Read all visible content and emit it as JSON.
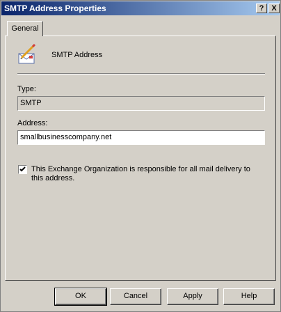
{
  "window": {
    "title": "SMTP Address Properties",
    "help_button": "?",
    "close_button": "X"
  },
  "tabs": [
    {
      "label": "General",
      "selected": true
    }
  ],
  "header": {
    "icon": "envelope-pen-icon",
    "label": "SMTP Address"
  },
  "type_field": {
    "label": "Type:",
    "value": "SMTP"
  },
  "address_field": {
    "label": "Address:",
    "value": "smallbusinesscompany.net"
  },
  "responsibility_checkbox": {
    "checked": true,
    "label": "This Exchange Organization is responsible for all mail delivery to this address."
  },
  "buttons": {
    "ok": "OK",
    "cancel": "Cancel",
    "apply": "Apply",
    "help": "Help"
  },
  "colors": {
    "dialog_background": "#d4d0c8",
    "titlebar_start": "#0a246a",
    "titlebar_end": "#a6caf0"
  }
}
